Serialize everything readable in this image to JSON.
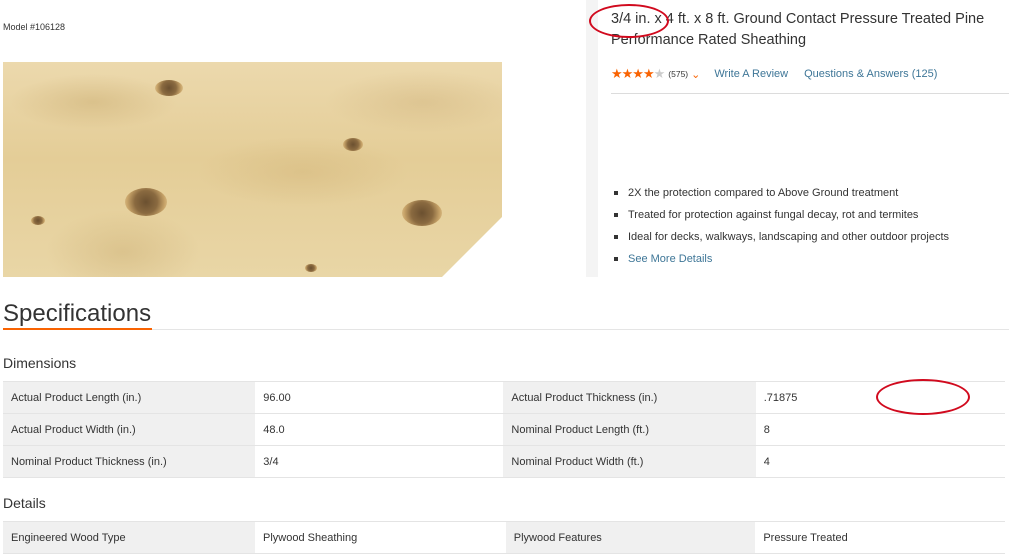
{
  "product": {
    "model": "Model #106128",
    "title": "3/4 in. x 4 ft. x 8 ft. Ground Contact Pressure Treated Pine Performance Rated Sheathing",
    "rating": {
      "stars": 4.5,
      "stars_text": "★★★★",
      "half_star_text": "★",
      "count": "(575)",
      "write_review": "Write A Review",
      "questions": "Questions & Answers (125)"
    },
    "highlights": [
      "2X the protection compared to Above Ground treatment",
      "Treated for protection against fungal decay, rot and termites",
      "Ideal for decks, walkways, landscaping and other outdoor projects"
    ],
    "see_more": "See More Details"
  },
  "specifications": {
    "heading": "Specifications",
    "dimensions": {
      "heading": "Dimensions",
      "rows": [
        [
          "Actual Product Length (in.)",
          "96.00",
          "Actual Product Thickness (in.)",
          ".71875"
        ],
        [
          "Actual Product Width (in.)",
          "48.0",
          "Nominal Product Length (ft.)",
          "8"
        ],
        [
          "Nominal Product Thickness (in.)",
          "3/4",
          "Nominal Product Width (ft.)",
          "4"
        ]
      ]
    },
    "details": {
      "heading": "Details",
      "rows": [
        [
          "Engineered Wood Type",
          "Plywood Sheathing",
          "Plywood Features",
          "Pressure Treated"
        ]
      ]
    }
  },
  "colors": {
    "accent": "#f96302",
    "link": "#3e7697",
    "annotation": "#d10a1e"
  }
}
